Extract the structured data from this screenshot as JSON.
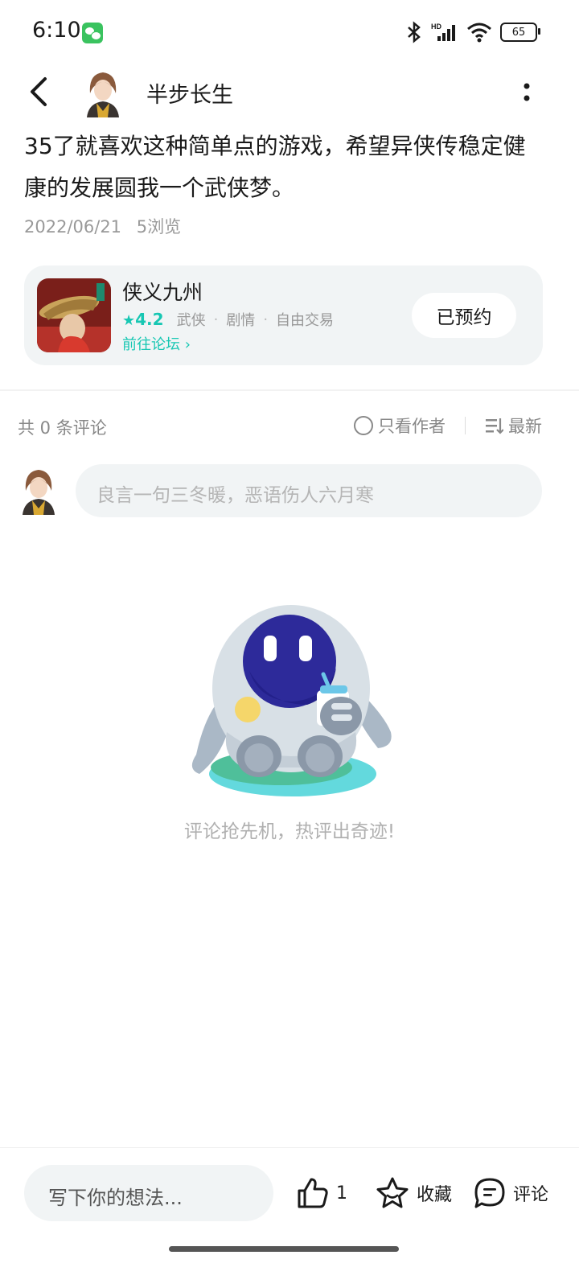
{
  "status_bar": {
    "time": "6:10",
    "battery": "65"
  },
  "header": {
    "author_name": "半步长生"
  },
  "post": {
    "text": "35了就喜欢这种简单点的游戏，希望异侠传稳定健康的发展圆我一个武侠梦。",
    "date": "2022/06/21",
    "views": "5浏览"
  },
  "game_card": {
    "name": "侠义九州",
    "rating": "4.2",
    "tags": [
      "武侠",
      "剧情",
      "自由交易"
    ],
    "forum_link": "前往论坛",
    "reserve_label": "已预约"
  },
  "comments": {
    "count_label": "共 0 条评论",
    "author_only_label": "只看作者",
    "sort_label": "最新",
    "input_placeholder": "良言一句三冬暖，恶语伤人六月寒",
    "empty_text": "评论抢先机，热评出奇迹!"
  },
  "bottom_bar": {
    "write_placeholder": "写下你的想法...",
    "like_count": "1",
    "favorite_label": "收藏",
    "comment_label": "评论"
  },
  "colors": {
    "accent": "#17c7b3",
    "card_bg": "#f1f4f5",
    "wechat_green": "#3ac35f"
  }
}
